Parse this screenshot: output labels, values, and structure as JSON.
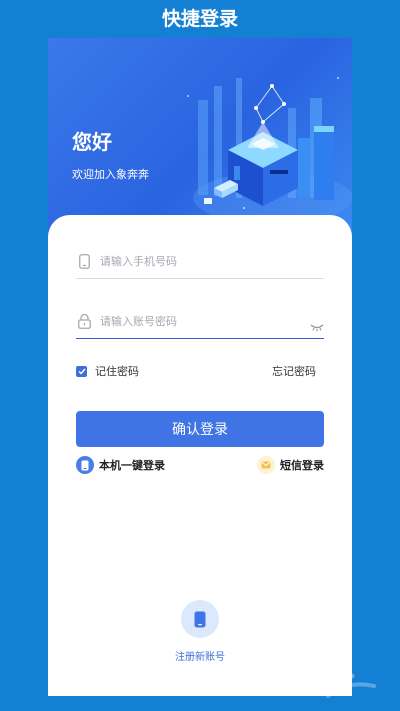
{
  "header": {
    "title": "快捷登录"
  },
  "hero": {
    "greeting": "您好",
    "subtitle": "欢迎加入象奔奔"
  },
  "form": {
    "phone_placeholder": "请输入手机号码",
    "password_placeholder": "请输入账号密码",
    "remember_label": "记住密码",
    "remember_checked": true,
    "forgot_label": "忘记密码",
    "submit_label": "确认登录"
  },
  "alt_login": {
    "one_tap_label": "本机一键登录",
    "sms_label": "短信登录"
  },
  "register": {
    "label": "注册新账号"
  },
  "icons": {
    "phone": "phone-icon",
    "lock": "lock-icon",
    "eye": "eye-closed-icon",
    "check": "check-icon",
    "one_tap": "mobile-icon",
    "sms": "envelope-icon",
    "register": "mobile-icon"
  },
  "colors": {
    "background": "#1480d4",
    "primary": "#4073e3",
    "hero": "#2a63e0",
    "link": "#3b6fd6"
  }
}
